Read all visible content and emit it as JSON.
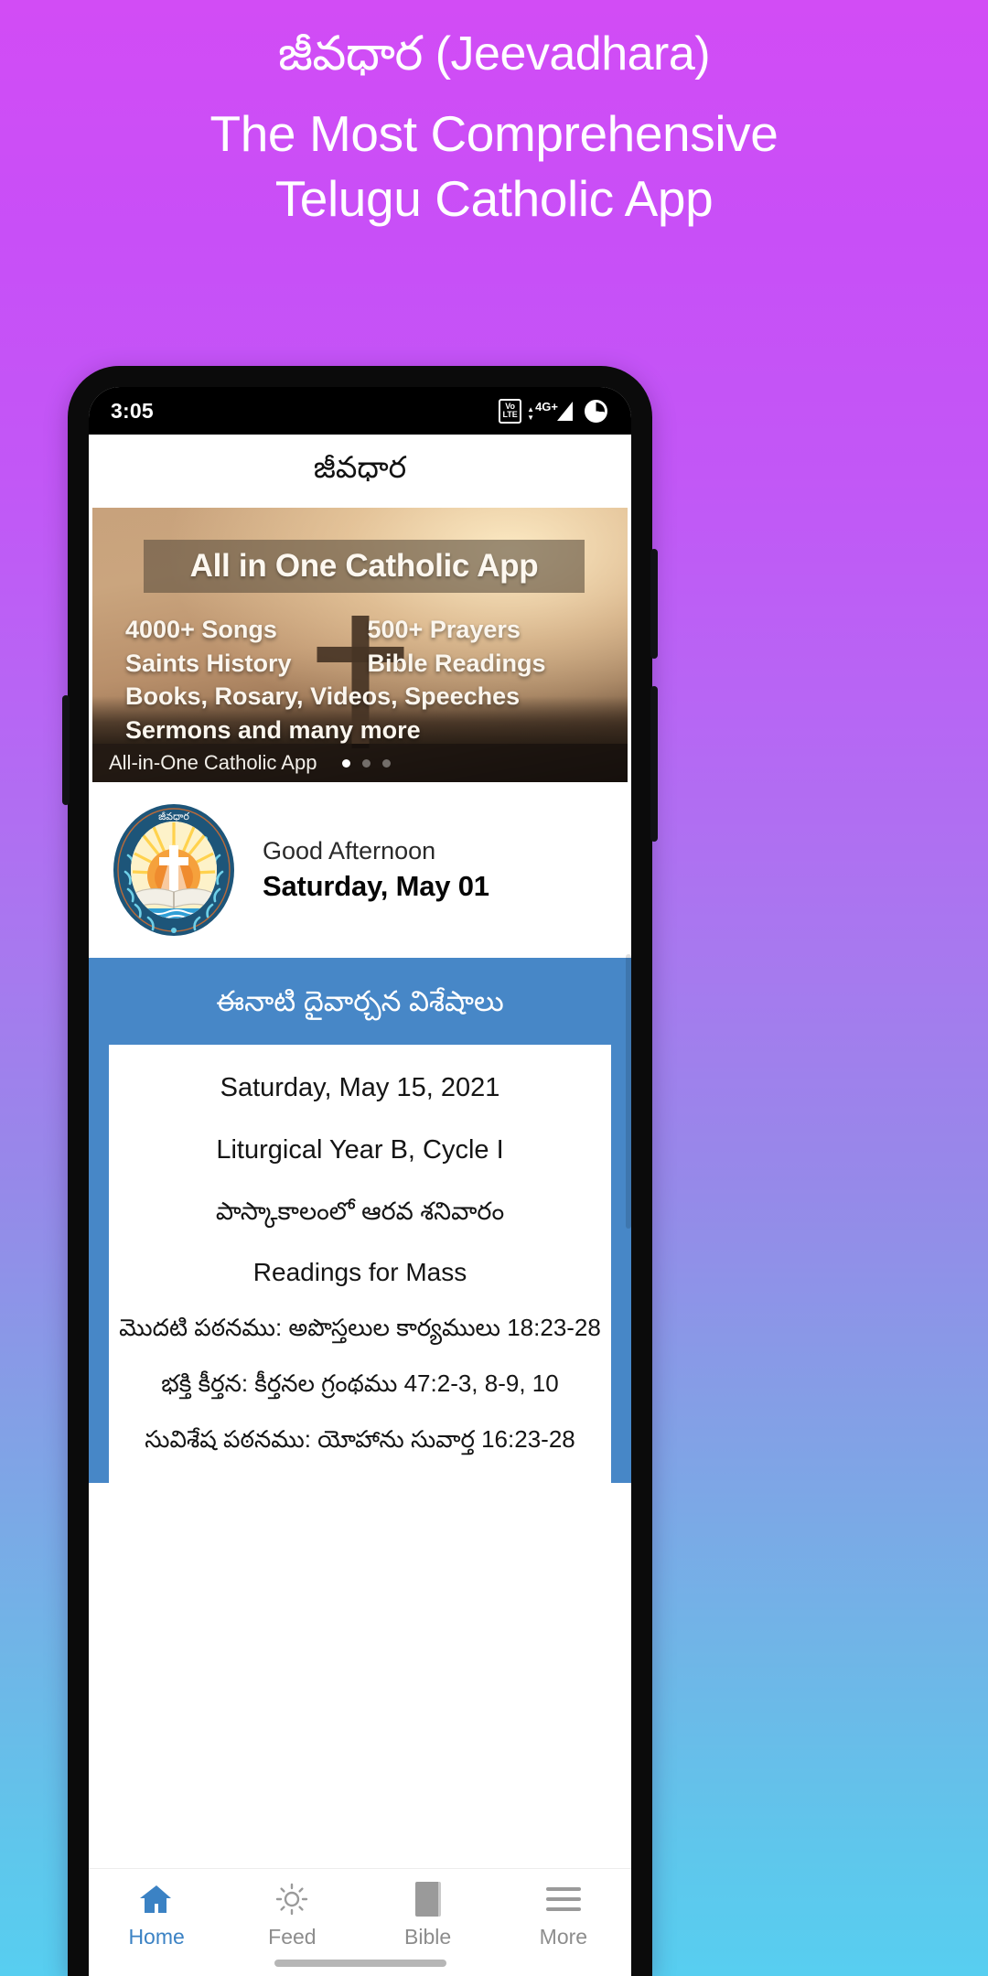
{
  "promo": {
    "line1": "జీవధార (Jeevadhara)",
    "line2": "The Most Comprehensive",
    "line3": "Telugu Catholic App"
  },
  "statusbar": {
    "time": "3:05",
    "volte_top": "Vo",
    "volte_bottom": "LTE",
    "network": "4G+",
    "battery_icon": "battery-charging-icon"
  },
  "appbar": {
    "title": "జీవధార"
  },
  "hero": {
    "title": "All in One Catholic App",
    "features": [
      {
        "left": "4000+ Songs",
        "right": "500+ Prayers"
      },
      {
        "left": "Saints History",
        "right": "Bible Readings"
      },
      {
        "full": "Books, Rosary, Videos, Speeches"
      },
      {
        "full": "Sermons and many more"
      }
    ],
    "caption": "All-in-One Catholic App",
    "dots_total": 3,
    "dot_active": 1
  },
  "greeting": {
    "logo_name": "jeevadhara-logo",
    "logo_text": "జీవధార",
    "salutation": "Good Afternoon",
    "date": "Saturday, May 01"
  },
  "liturgy": {
    "header": "ఈనాటి దైవార్చన విశేషాలు",
    "date": "Saturday, May 15, 2021",
    "year_cycle": "Liturgical Year B, Cycle I",
    "season_telugu": "పాస్కాకాలంలో ఆరవ శనివారం",
    "readings_heading": "Readings for Mass",
    "readings": [
      "మొదటి పఠనము: అపొస్తలుల  కార్యములు 18:23-28",
      "భక్తి కీర్తన: కీర్తనల గ్రంథము 47:2-3, 8-9, 10",
      "సువిశేష పఠనము: యోహాను సువార్త 16:23-28"
    ]
  },
  "bottomnav": {
    "items": [
      {
        "label": "Home",
        "icon": "home-icon",
        "active": true
      },
      {
        "label": "Feed",
        "icon": "sun-icon",
        "active": false
      },
      {
        "label": "Bible",
        "icon": "book-icon",
        "active": false
      },
      {
        "label": "More",
        "icon": "menu-icon",
        "active": false
      }
    ]
  },
  "colors": {
    "accent_blue": "#3b82c4",
    "section_blue": "#4787c7",
    "promo_top": "#d24cf5",
    "promo_bottom": "#57cef0"
  }
}
